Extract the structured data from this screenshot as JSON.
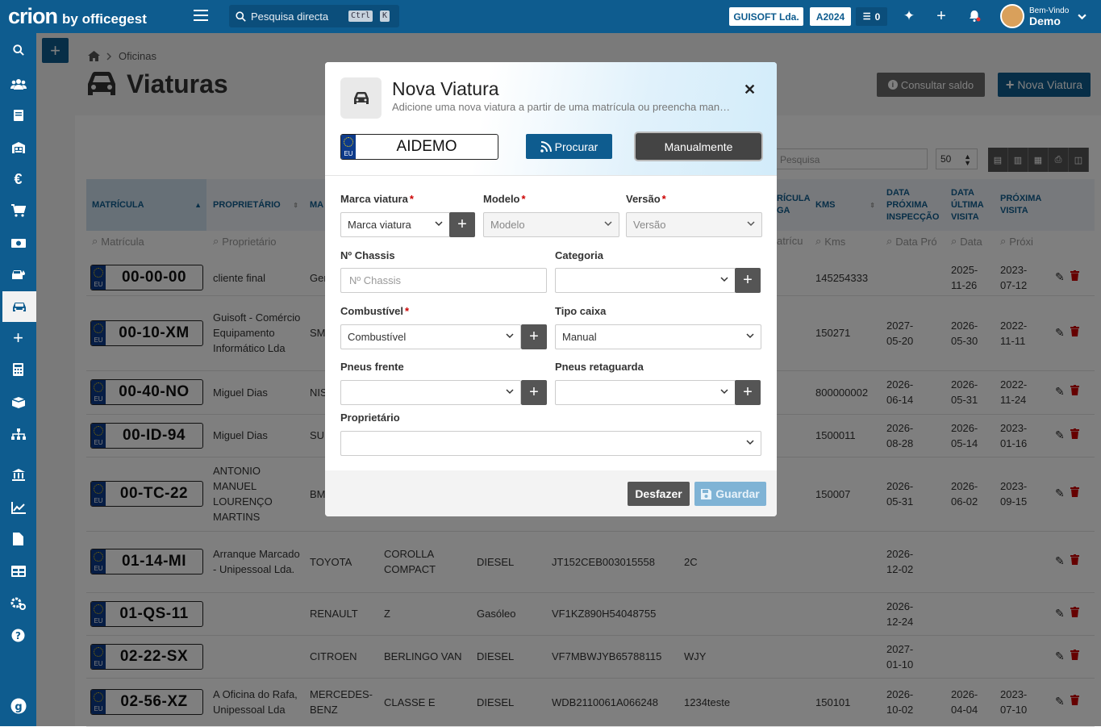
{
  "topbar": {
    "brand": "crion",
    "brand_sub": "by officegest",
    "search_placeholder": "Pesquisa directa",
    "kbd1": "Ctrl",
    "kbd2": "K",
    "company": "GUISOFT Lda.",
    "year": "A2024",
    "tasks_count": "0",
    "welcome": "Bem-Vindo",
    "user": "Demo"
  },
  "sidebar": {
    "icons": [
      "search-icon",
      "users-icon",
      "book-icon",
      "warehouse-icon",
      "euro-icon",
      "cart-icon",
      "cash-icon",
      "car-wash-icon",
      "car-icon",
      "plus-icon",
      "calculator-icon",
      "box-icon",
      "sitemap-icon",
      "bank-icon",
      "chart-icon",
      "file-icon",
      "table-icon",
      "cogs-icon",
      "help-icon",
      "guisoft-icon"
    ]
  },
  "page": {
    "breadcrumb": "Oficinas",
    "title": "Viaturas",
    "consult_label": "Consultar saldo",
    "nova_label": "Nova Viatura",
    "search_placeholder": "Pesquisa",
    "page_len": "50"
  },
  "table": {
    "headers": {
      "matricula": "MATRÍCULA",
      "proprietario": "PROPRIETÁRIO",
      "marca": "MA",
      "matricula_reboque": "RÍCULA GA",
      "kms": "KMS",
      "inspeccao": "DATA PRÓXIMA INSPECÇÃO",
      "ultima": "DATA ÚLTIMA VISITA",
      "proxima": "PRÓXIMA VISITA"
    },
    "filters": {
      "matricula": "Matrícula",
      "proprietario": "Proprietário",
      "matricula_reboque": "atrícu",
      "kms": "Kms",
      "inspeccao": "Data Pró",
      "ultima": "Data",
      "proxima": "Próxi"
    },
    "rows": [
      {
        "plate": "00-00-00",
        "owner": "cliente final",
        "brand": "Ger",
        "model": "",
        "fuel": "",
        "chassis": "",
        "cat": "",
        "kms": "145254333",
        "insp": "",
        "ult": "2025-11-26",
        "prox": "2023-07-12"
      },
      {
        "plate": "00-10-XM",
        "owner": "Guisoft - Comércio Equipamento Informático Lda",
        "brand": "SM",
        "model": "",
        "fuel": "",
        "chassis": "",
        "cat": "",
        "kms": "150271",
        "insp": "2027-05-20",
        "ult": "2026-05-30",
        "prox": "2022-11-11"
      },
      {
        "plate": "00-40-NO",
        "owner": "Miguel Dias",
        "brand": "NIS",
        "model": "",
        "fuel": "",
        "chassis": "",
        "cat": "",
        "kms": "800000002",
        "insp": "2026-06-14",
        "ult": "2026-05-31",
        "prox": "2022-11-24"
      },
      {
        "plate": "00-ID-94",
        "owner": "Miguel Dias",
        "brand": "SU",
        "model": "",
        "fuel": "",
        "chassis": "",
        "cat": "",
        "kms": "1500011",
        "insp": "2026-08-28",
        "ult": "2026-05-14",
        "prox": "2023-01-16"
      },
      {
        "plate": "00-TC-22",
        "owner": "ANTONIO MANUEL LOURENÇO MARTINS",
        "brand": "BM",
        "model": "",
        "fuel": "",
        "chassis": "",
        "cat": "",
        "kms": "150007",
        "insp": "2026-05-31",
        "ult": "2026-06-02",
        "prox": "2023-09-15"
      },
      {
        "plate": "01-14-MI",
        "owner": "Arranque Marcado - Unipessoal Lda.",
        "brand": "TOYOTA",
        "model": "COROLLA COMPACT",
        "fuel": "DIESEL",
        "chassis": "JT152CEB003015558",
        "cat": "2C",
        "kms": "",
        "insp": "2026-12-02",
        "ult": "",
        "prox": ""
      },
      {
        "plate": "01-QS-11",
        "owner": "",
        "brand": "RENAULT",
        "model": "Z",
        "fuel": "Gasóleo",
        "chassis": "VF1KZ890H54048755",
        "cat": "",
        "kms": "",
        "insp": "2026-12-24",
        "ult": "",
        "prox": ""
      },
      {
        "plate": "02-22-SX",
        "owner": "",
        "brand": "CITROEN",
        "model": "BERLINGO VAN",
        "fuel": "DIESEL",
        "chassis": "VF7MBWJYB65788115",
        "cat": "WJY",
        "kms": "",
        "insp": "2027-01-10",
        "ult": "",
        "prox": ""
      },
      {
        "plate": "02-56-XZ",
        "owner": "A Oficina do Rafa, Unipessoal Lda",
        "brand": "MERCEDES-BENZ",
        "model": "CLASSE E",
        "fuel": "DIESEL",
        "chassis": "WDB2110061A066248",
        "cat": "1234teste",
        "kms": "150101",
        "insp": "2026-10-02",
        "ult": "2026-04-04",
        "prox": "2023-07-10"
      }
    ]
  },
  "modal": {
    "title": "Nova Viatura",
    "subtitle": "Adicione uma nova viatura a partir de uma matrícula ou preencha manualmente",
    "plate_value": "AIDEMO",
    "plate_eu": "EU",
    "procurar_label": "Procurar",
    "manual_label": "Manualmente",
    "fields": {
      "marca_label": "Marca viatura",
      "marca_value": "Marca viatura",
      "modelo_label": "Modelo",
      "modelo_value": "Modelo",
      "versao_label": "Versão",
      "versao_value": "Versão",
      "chassis_label": "Nº Chassis",
      "chassis_placeholder": "Nº Chassis",
      "categoria_label": "Categoria",
      "combustivel_label": "Combustível",
      "combustivel_value": "Combustível",
      "caixa_label": "Tipo caixa",
      "caixa_value": "Manual",
      "pneus_frente_label": "Pneus frente",
      "pneus_ret_label": "Pneus retaguarda",
      "proprietario_label": "Proprietário"
    },
    "undo_label": "Desfazer",
    "save_label": "Guardar"
  }
}
